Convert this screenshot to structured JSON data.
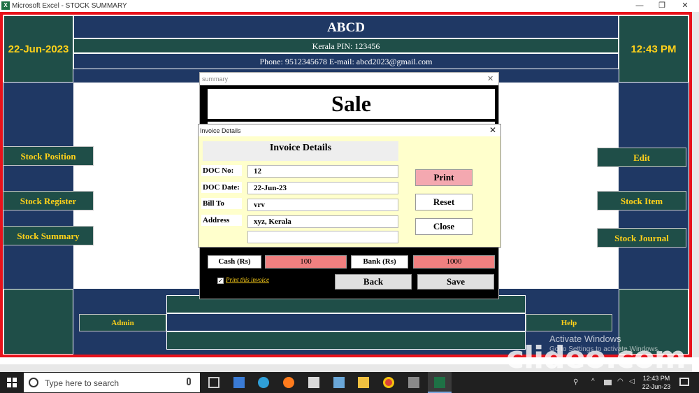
{
  "window": {
    "title": "Microsoft Excel - STOCK SUMMARY",
    "app_icon": "X",
    "minimize": "—",
    "restore": "❐",
    "close": "✕"
  },
  "header": {
    "date": "22-Jun-2023",
    "time": "12:43 PM",
    "company": "ABCD",
    "address": "Kerala  PIN: 123456",
    "contact": "Phone: 9512345678  E-mail: abcd2023@gmail.com"
  },
  "left_menu": {
    "stock_position": "Stock Position",
    "stock_register": "Stock Register",
    "stock_summary": "Stock Summary"
  },
  "right_menu": {
    "edit": "Edit",
    "stock_item": "Stock Item",
    "stock_journal": "Stock Journal"
  },
  "footer": {
    "admin": "Admin",
    "help": "Help"
  },
  "summary_dialog": {
    "caption": "summary",
    "close": "✕",
    "heading": "Sale",
    "cash_label": "Cash (Rs)",
    "cash_value": "100",
    "bank_label": "Bank (Rs)",
    "bank_value": "1000",
    "print_checkbox": "Print this invoice",
    "print_checked": true,
    "back": "Back",
    "save": "Save"
  },
  "invoice_dialog": {
    "caption": "Invoice Details",
    "close": "✕",
    "heading": "Invoice Details",
    "doc_no_label": "DOC No:",
    "doc_no": "12",
    "doc_date_label": "DOC Date:",
    "doc_date": "22-Jun-23",
    "bill_to_label": "Bill To",
    "bill_to": "vrv",
    "address_label": "Address",
    "address_line1": "xyz, Kerala",
    "address_line2": "",
    "print": "Print",
    "reset": "Reset",
    "close_button": "Close"
  },
  "watermark": {
    "brand": "clideo.com",
    "activate_line1": "Activate Windows",
    "activate_line2": "Go to Settings to activate Windows."
  },
  "taskbar": {
    "search_placeholder": "Type here to search",
    "clock_time": "12:43 PM",
    "clock_date": "22-Jun-23"
  },
  "colors": {
    "frame_red": "#e8121b",
    "navy": "#1f3864",
    "teal": "#1f4e48",
    "gold": "#ffd11a",
    "salmon": "#f08080",
    "cream": "#ffffcc"
  }
}
